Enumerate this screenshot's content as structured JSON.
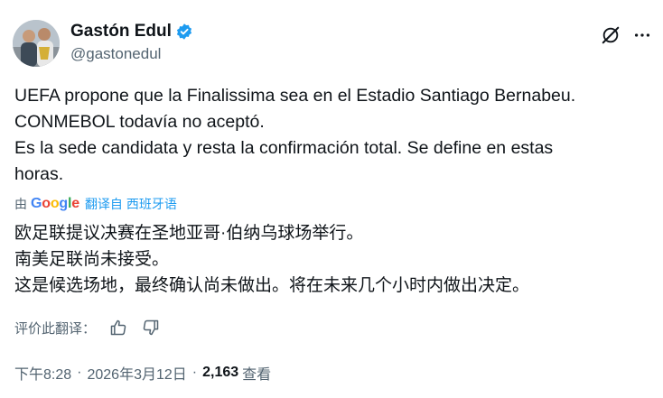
{
  "author": {
    "display_name": "Gastón Edul",
    "handle": "@gastonedul",
    "verified": true,
    "verified_color": "#1d9bf0"
  },
  "header_icons": {
    "grok": "grok-icon",
    "more": "more-icon"
  },
  "tweet": {
    "lines": [
      "UEFA propone que la Finalissima sea en el Estadio Santiago Bernabeu.",
      "CONMEBOL todavía no aceptó.",
      "Es la sede candidata y resta la confirmación total. Se define en estas",
      "horas."
    ]
  },
  "translation": {
    "by_label": "由",
    "provider": "Google",
    "translated_from": "翻译自 西班牙语",
    "lines": [
      "欧足联提议决赛在圣地亚哥·伯纳乌球场举行。",
      "南美足联尚未接受。",
      "这是候选场地，最终确认尚未做出。将在未来几个小时内做出决定。"
    ],
    "rate_label": "评价此翻译："
  },
  "meta": {
    "time": "下午8:28",
    "separator": "·",
    "date": "2026年3月12日",
    "views_count": "2,163",
    "views_label": "查看"
  },
  "colors": {
    "text": "#0f1419",
    "secondary": "#536471",
    "link": "#1d9bf0"
  }
}
